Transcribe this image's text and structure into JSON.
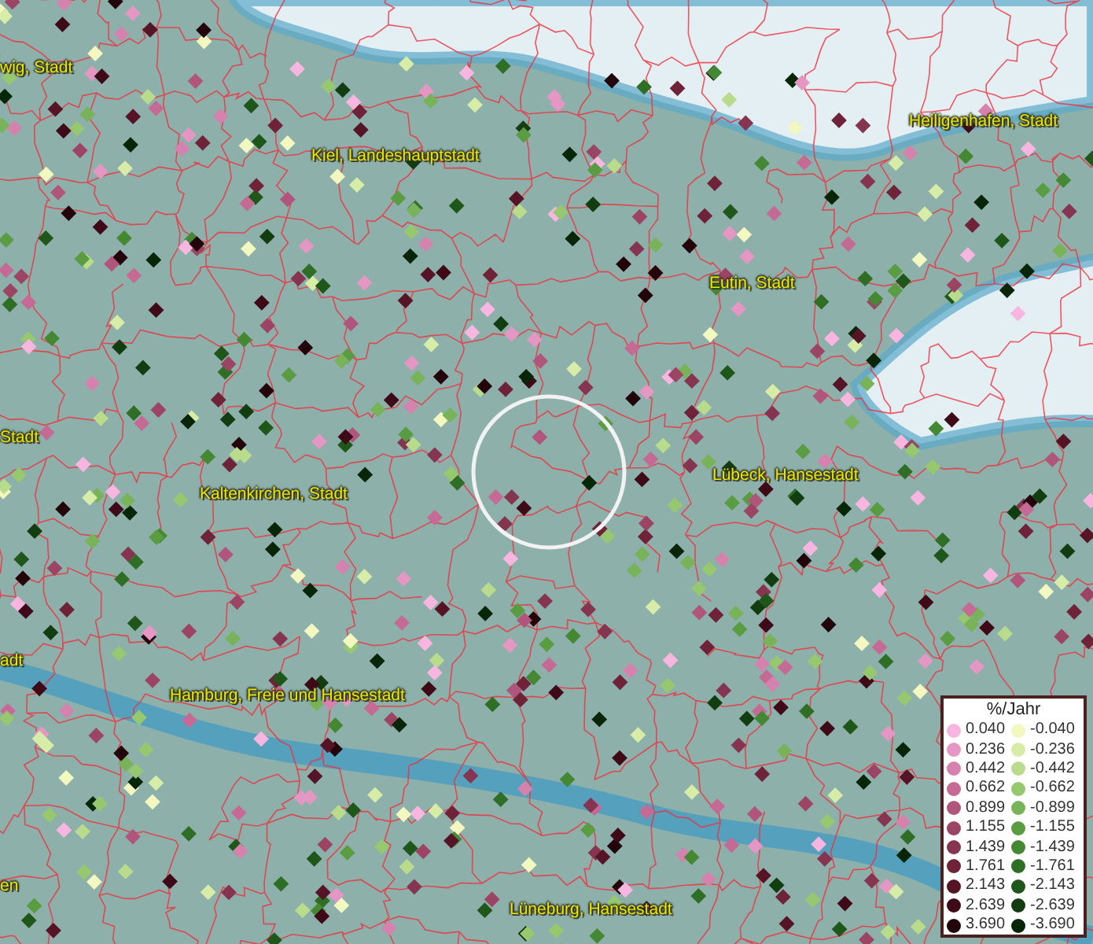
{
  "map": {
    "places": [
      {
        "name": "wig, Stadt"
      },
      {
        "name": "Kiel, Landeshauptstadt"
      },
      {
        "name": "Heiligenhafen, Stadt"
      },
      {
        "name": "Eutin, Stadt"
      },
      {
        "name": "Stadt"
      },
      {
        "name": "Kaltenkirchen, Stadt"
      },
      {
        "name": "Lübeck, Hansestadt"
      },
      {
        "name": "adt"
      },
      {
        "name": "Hamburg, Freie und Hansestadt"
      },
      {
        "name": "en"
      },
      {
        "name": "Lüneburg, Hansestadt"
      }
    ]
  },
  "legend": {
    "title": "%/Jahr",
    "rows": [
      {
        "positive": {
          "label": "0.040",
          "color": "#f7b6e0"
        },
        "negative": {
          "label": "-0.040",
          "color": "#f3f7c0"
        }
      },
      {
        "positive": {
          "label": "0.236",
          "color": "#e597c4"
        },
        "negative": {
          "label": "-0.236",
          "color": "#d7eca6"
        }
      },
      {
        "positive": {
          "label": "0.442",
          "color": "#d682ae"
        },
        "negative": {
          "label": "-0.442",
          "color": "#b9dc8c"
        }
      },
      {
        "positive": {
          "label": "0.662",
          "color": "#c46a94"
        },
        "negative": {
          "label": "-0.662",
          "color": "#96c870"
        }
      },
      {
        "positive": {
          "label": "0.899",
          "color": "#b0557c"
        },
        "negative": {
          "label": "-0.899",
          "color": "#78b35a"
        }
      },
      {
        "positive": {
          "label": "1.155",
          "color": "#9c4464"
        },
        "negative": {
          "label": "-1.155",
          "color": "#5a9c42"
        }
      },
      {
        "positive": {
          "label": "1.439",
          "color": "#853550"
        },
        "negative": {
          "label": "-1.439",
          "color": "#448834"
        }
      },
      {
        "positive": {
          "label": "1.761",
          "color": "#6e2339"
        },
        "negative": {
          "label": "-1.761",
          "color": "#2f6e25"
        }
      },
      {
        "positive": {
          "label": "2.143",
          "color": "#561526"
        },
        "negative": {
          "label": "-2.143",
          "color": "#1f561a"
        }
      },
      {
        "positive": {
          "label": "2.639",
          "color": "#3e0a17"
        },
        "negative": {
          "label": "-2.639",
          "color": "#123d10"
        }
      },
      {
        "positive": {
          "label": "3.690",
          "color": "#22040a"
        },
        "negative": {
          "label": "-3.690",
          "color": "#072507"
        }
      }
    ]
  }
}
